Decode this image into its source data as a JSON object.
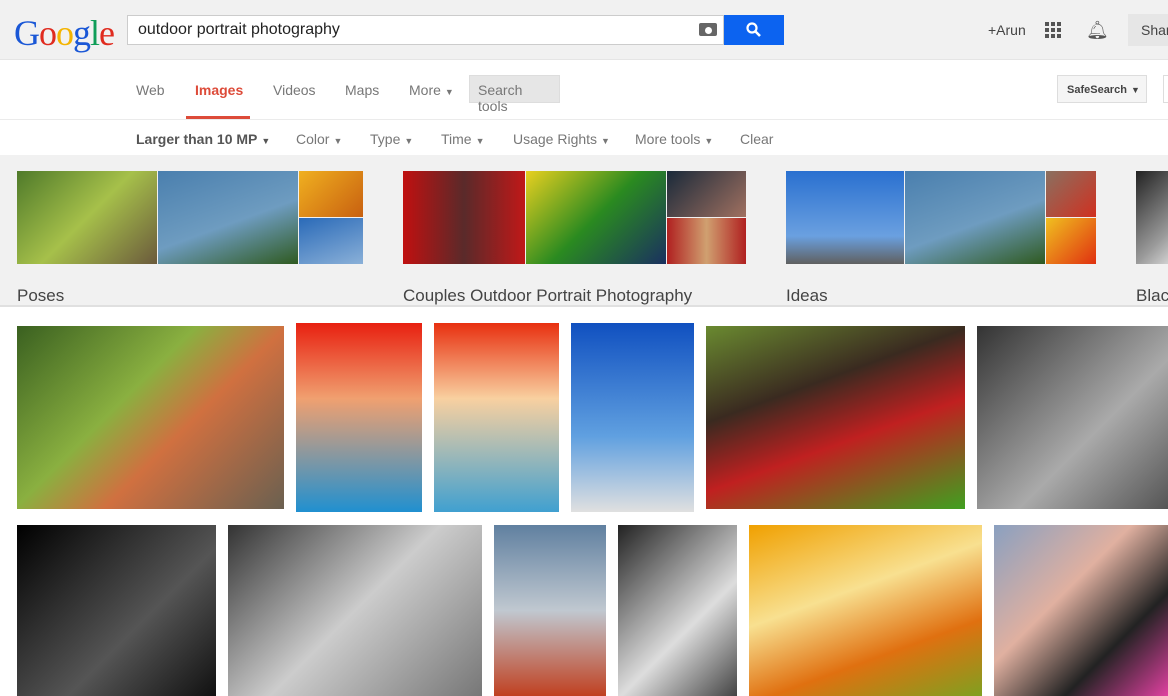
{
  "header": {
    "logo": "Google",
    "query": "outdoor portrait photography",
    "user": "+Arun",
    "share": "Share"
  },
  "nav": {
    "tabs": [
      {
        "label": "Web"
      },
      {
        "label": "Images",
        "active": true
      },
      {
        "label": "Videos"
      },
      {
        "label": "Maps"
      },
      {
        "label": "More"
      }
    ],
    "search_tools": "Search tools",
    "safesearch": "SafeSearch"
  },
  "tools": {
    "items": [
      {
        "label": "Larger than 10 MP"
      },
      {
        "label": "Color"
      },
      {
        "label": "Type"
      },
      {
        "label": "Time"
      },
      {
        "label": "Usage Rights"
      },
      {
        "label": "More tools"
      },
      {
        "label": "Clear"
      }
    ]
  },
  "related": [
    {
      "label": "Poses"
    },
    {
      "label": "Couples Outdoor Portrait Photography"
    },
    {
      "label": "Ideas"
    },
    {
      "label": "Black"
    }
  ],
  "colors": {
    "accent": "#dd4b39",
    "search_button": "#0c63f0"
  }
}
